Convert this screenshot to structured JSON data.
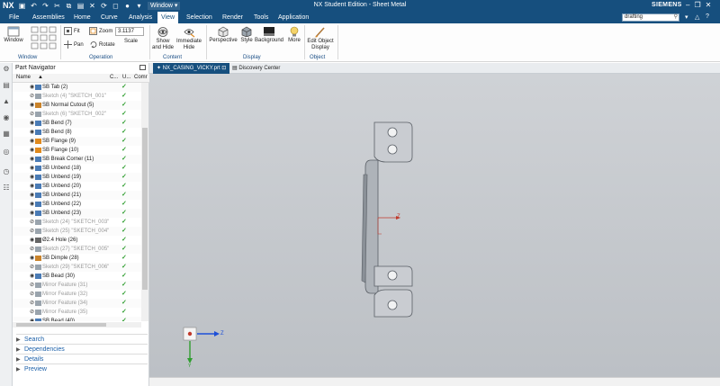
{
  "app": {
    "logo": "NX",
    "title": "NX Student Edition - Sheet Metal",
    "brand": "SIEMENS",
    "window_menu": "Window ▾"
  },
  "menu": {
    "tabs": [
      "File",
      "Assemblies",
      "Home",
      "Curve",
      "Analysis",
      "View",
      "Selection",
      "Render",
      "Tools",
      "Application"
    ],
    "active": "View"
  },
  "search": {
    "value": "drafting"
  },
  "ribbon": {
    "groups": {
      "window": "Window",
      "operation": "Operation",
      "content": "Content",
      "display": "Display",
      "object": "Object"
    },
    "window_btn": "Window",
    "fit": "Fit",
    "pan": "Pan",
    "zoom": "Zoom",
    "rotate": "Rotate",
    "scale_value": "3.1137",
    "scale_label": "Scale",
    "show_and_hide": [
      "Show",
      "and Hide"
    ],
    "immediate_hide": [
      "Immediate",
      "Hide"
    ],
    "perspective": "Perspective",
    "style": "Style",
    "background": "Background",
    "more": "More",
    "edit_object_display": [
      "Edit Object",
      "Display"
    ]
  },
  "navigator": {
    "title": "Part Navigator",
    "columns": [
      "Name",
      "C...",
      "U...",
      "Comr"
    ],
    "rows": [
      {
        "label": "SB Tab (2)",
        "dim": false,
        "icon": "tab"
      },
      {
        "label": "Sketch (4) \"SKETCH_001\"",
        "dim": true,
        "icon": "sketch"
      },
      {
        "label": "SB Normal Cutout (5)",
        "dim": false,
        "icon": "cutout"
      },
      {
        "label": "Sketch (6) \"SKETCH_002\"",
        "dim": true,
        "icon": "sketch"
      },
      {
        "label": "SB Bend (7)",
        "dim": false,
        "icon": "bend"
      },
      {
        "label": "SB Bend (8)",
        "dim": false,
        "icon": "bend"
      },
      {
        "label": "SB Flange (9)",
        "dim": false,
        "icon": "flange"
      },
      {
        "label": "SB Flange (10)",
        "dim": false,
        "icon": "flange"
      },
      {
        "label": "SB Break Corner (11)",
        "dim": false,
        "icon": "corner"
      },
      {
        "label": "SB Unbend (18)",
        "dim": false,
        "icon": "unbend"
      },
      {
        "label": "SB Unbend (19)",
        "dim": false,
        "icon": "unbend"
      },
      {
        "label": "SB Unbend (20)",
        "dim": false,
        "icon": "unbend"
      },
      {
        "label": "SB Unbend (21)",
        "dim": false,
        "icon": "unbend"
      },
      {
        "label": "SB Unbend (22)",
        "dim": false,
        "icon": "unbend"
      },
      {
        "label": "SB Unbend (23)",
        "dim": false,
        "icon": "unbend"
      },
      {
        "label": "Sketch (24) \"SKETCH_003\"",
        "dim": true,
        "icon": "sketch"
      },
      {
        "label": "Sketch (25) \"SKETCH_004\"",
        "dim": true,
        "icon": "sketch"
      },
      {
        "label": "Ø2.4 Hole (26)",
        "dim": false,
        "icon": "hole"
      },
      {
        "label": "Sketch (27) \"SKETCH_005\"",
        "dim": true,
        "icon": "sketch"
      },
      {
        "label": "SB Dimple (28)",
        "dim": false,
        "icon": "dimple"
      },
      {
        "label": "Sketch (29) \"SKETCH_006\"",
        "dim": true,
        "icon": "sketch"
      },
      {
        "label": "SB Bead (30)",
        "dim": false,
        "icon": "bead"
      },
      {
        "label": "Mirror Feature (31)",
        "dim": true,
        "icon": "mirror"
      },
      {
        "label": "Mirror Feature (32)",
        "dim": true,
        "icon": "mirror"
      },
      {
        "label": "Mirror Feature (34)",
        "dim": true,
        "icon": "mirror"
      },
      {
        "label": "Mirror Feature (35)",
        "dim": true,
        "icon": "mirror"
      },
      {
        "label": "SB Bead (40)",
        "dim": false,
        "icon": "bead"
      }
    ],
    "check": "✓",
    "panels": [
      "Search",
      "Dependencies",
      "Details",
      "Preview"
    ]
  },
  "doc_tabs": {
    "active": "NX_CASING_VICKY.prt",
    "active_close": "⊡",
    "other": "Discovery Center"
  },
  "viewport": {
    "axis_z": "Z",
    "axis_y": "Y",
    "axis_z_small": "Z",
    "colors": {
      "part_fill": "#c9ccd1",
      "part_edge": "#5a5f66",
      "axis_blue": "#1d4fd8",
      "axis_red": "#c0392b"
    }
  }
}
